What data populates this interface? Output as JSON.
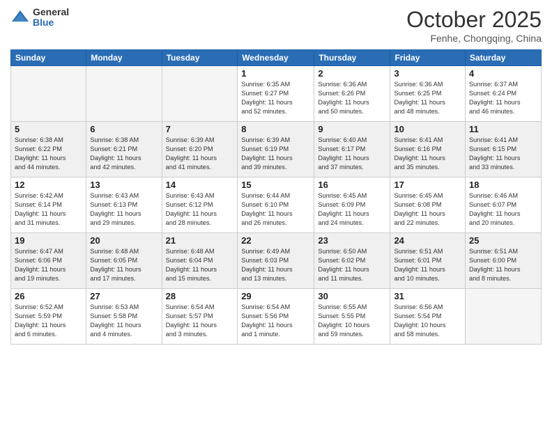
{
  "logo": {
    "general": "General",
    "blue": "Blue"
  },
  "title": "October 2025",
  "location": "Fenhe, Chongqing, China",
  "weekdays": [
    "Sunday",
    "Monday",
    "Tuesday",
    "Wednesday",
    "Thursday",
    "Friday",
    "Saturday"
  ],
  "weeks": [
    [
      {
        "day": "",
        "info": ""
      },
      {
        "day": "",
        "info": ""
      },
      {
        "day": "",
        "info": ""
      },
      {
        "day": "1",
        "info": "Sunrise: 6:35 AM\nSunset: 6:27 PM\nDaylight: 11 hours\nand 52 minutes."
      },
      {
        "day": "2",
        "info": "Sunrise: 6:36 AM\nSunset: 6:26 PM\nDaylight: 11 hours\nand 50 minutes."
      },
      {
        "day": "3",
        "info": "Sunrise: 6:36 AM\nSunset: 6:25 PM\nDaylight: 11 hours\nand 48 minutes."
      },
      {
        "day": "4",
        "info": "Sunrise: 6:37 AM\nSunset: 6:24 PM\nDaylight: 11 hours\nand 46 minutes."
      }
    ],
    [
      {
        "day": "5",
        "info": "Sunrise: 6:38 AM\nSunset: 6:22 PM\nDaylight: 11 hours\nand 44 minutes."
      },
      {
        "day": "6",
        "info": "Sunrise: 6:38 AM\nSunset: 6:21 PM\nDaylight: 11 hours\nand 42 minutes."
      },
      {
        "day": "7",
        "info": "Sunrise: 6:39 AM\nSunset: 6:20 PM\nDaylight: 11 hours\nand 41 minutes."
      },
      {
        "day": "8",
        "info": "Sunrise: 6:39 AM\nSunset: 6:19 PM\nDaylight: 11 hours\nand 39 minutes."
      },
      {
        "day": "9",
        "info": "Sunrise: 6:40 AM\nSunset: 6:17 PM\nDaylight: 11 hours\nand 37 minutes."
      },
      {
        "day": "10",
        "info": "Sunrise: 6:41 AM\nSunset: 6:16 PM\nDaylight: 11 hours\nand 35 minutes."
      },
      {
        "day": "11",
        "info": "Sunrise: 6:41 AM\nSunset: 6:15 PM\nDaylight: 11 hours\nand 33 minutes."
      }
    ],
    [
      {
        "day": "12",
        "info": "Sunrise: 6:42 AM\nSunset: 6:14 PM\nDaylight: 11 hours\nand 31 minutes."
      },
      {
        "day": "13",
        "info": "Sunrise: 6:43 AM\nSunset: 6:13 PM\nDaylight: 11 hours\nand 29 minutes."
      },
      {
        "day": "14",
        "info": "Sunrise: 6:43 AM\nSunset: 6:12 PM\nDaylight: 11 hours\nand 28 minutes."
      },
      {
        "day": "15",
        "info": "Sunrise: 6:44 AM\nSunset: 6:10 PM\nDaylight: 11 hours\nand 26 minutes."
      },
      {
        "day": "16",
        "info": "Sunrise: 6:45 AM\nSunset: 6:09 PM\nDaylight: 11 hours\nand 24 minutes."
      },
      {
        "day": "17",
        "info": "Sunrise: 6:45 AM\nSunset: 6:08 PM\nDaylight: 11 hours\nand 22 minutes."
      },
      {
        "day": "18",
        "info": "Sunrise: 6:46 AM\nSunset: 6:07 PM\nDaylight: 11 hours\nand 20 minutes."
      }
    ],
    [
      {
        "day": "19",
        "info": "Sunrise: 6:47 AM\nSunset: 6:06 PM\nDaylight: 11 hours\nand 19 minutes."
      },
      {
        "day": "20",
        "info": "Sunrise: 6:48 AM\nSunset: 6:05 PM\nDaylight: 11 hours\nand 17 minutes."
      },
      {
        "day": "21",
        "info": "Sunrise: 6:48 AM\nSunset: 6:04 PM\nDaylight: 11 hours\nand 15 minutes."
      },
      {
        "day": "22",
        "info": "Sunrise: 6:49 AM\nSunset: 6:03 PM\nDaylight: 11 hours\nand 13 minutes."
      },
      {
        "day": "23",
        "info": "Sunrise: 6:50 AM\nSunset: 6:02 PM\nDaylight: 11 hours\nand 11 minutes."
      },
      {
        "day": "24",
        "info": "Sunrise: 6:51 AM\nSunset: 6:01 PM\nDaylight: 11 hours\nand 10 minutes."
      },
      {
        "day": "25",
        "info": "Sunrise: 6:51 AM\nSunset: 6:00 PM\nDaylight: 11 hours\nand 8 minutes."
      }
    ],
    [
      {
        "day": "26",
        "info": "Sunrise: 6:52 AM\nSunset: 5:59 PM\nDaylight: 11 hours\nand 6 minutes."
      },
      {
        "day": "27",
        "info": "Sunrise: 6:53 AM\nSunset: 5:58 PM\nDaylight: 11 hours\nand 4 minutes."
      },
      {
        "day": "28",
        "info": "Sunrise: 6:54 AM\nSunset: 5:57 PM\nDaylight: 11 hours\nand 3 minutes."
      },
      {
        "day": "29",
        "info": "Sunrise: 6:54 AM\nSunset: 5:56 PM\nDaylight: 11 hours\nand 1 minute."
      },
      {
        "day": "30",
        "info": "Sunrise: 6:55 AM\nSunset: 5:55 PM\nDaylight: 10 hours\nand 59 minutes."
      },
      {
        "day": "31",
        "info": "Sunrise: 6:56 AM\nSunset: 5:54 PM\nDaylight: 10 hours\nand 58 minutes."
      },
      {
        "day": "",
        "info": ""
      }
    ]
  ]
}
